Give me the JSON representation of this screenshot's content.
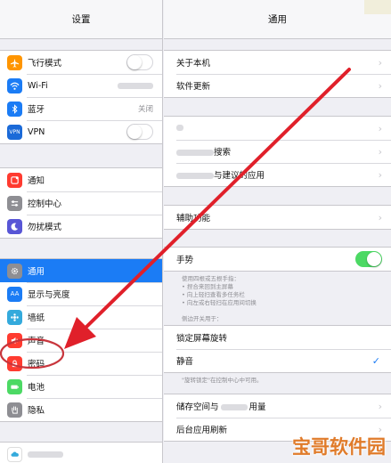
{
  "left": {
    "title": "设置",
    "group1": [
      {
        "label": "飞行模式",
        "icon": "airplane-icon",
        "color": "#ff9500",
        "control": "toggle",
        "on": false
      },
      {
        "label": "Wi-Fi",
        "icon": "wifi-icon",
        "color": "#1b7cf5",
        "control": "blurred"
      },
      {
        "label": "蓝牙",
        "icon": "bluetooth-icon",
        "color": "#1b7cf5",
        "control": "value",
        "value": "关闭"
      },
      {
        "label": "VPN",
        "icon": "vpn-icon",
        "color": "#1b6ad8",
        "icon_text": "VPN",
        "control": "toggle",
        "on": false
      }
    ],
    "group2": [
      {
        "label": "通知",
        "icon": "notifications-icon",
        "color": "#ff3b30"
      },
      {
        "label": "控制中心",
        "icon": "control-center-icon",
        "color": "#8e8e93"
      },
      {
        "label": "勿扰模式",
        "icon": "moon-icon",
        "color": "#5856d6"
      }
    ],
    "group3": [
      {
        "label": "通用",
        "icon": "gear-icon",
        "color": "#8e8e93",
        "selected": true
      },
      {
        "label": "显示与亮度",
        "icon": "display-icon",
        "color": "#1b7cf5",
        "icon_text": "AA"
      },
      {
        "label": "墙纸",
        "icon": "wallpaper-icon",
        "color": "#34aadc"
      },
      {
        "label": "声音",
        "icon": "sound-icon",
        "color": "#ff3b30"
      },
      {
        "label": "密码",
        "icon": "lock-icon",
        "color": "#ff3b30"
      },
      {
        "label": "电池",
        "icon": "battery-icon",
        "color": "#4cd964"
      },
      {
        "label": "隐私",
        "icon": "hand-icon",
        "color": "#8e8e93"
      }
    ]
  },
  "right": {
    "title": "通用",
    "group1": [
      "关于本机",
      "软件更新"
    ],
    "group2": [
      "",
      "搜索",
      "与建议的应用"
    ],
    "group3": [
      "辅助功能"
    ],
    "gestures": {
      "label": "手势",
      "on": true
    },
    "gestures_note": [
      "使用四根或五根手指：",
      "• 捏合来回到主屏幕",
      "• 向上轻扫查看多任务栏",
      "• 向左或右轻扫在应用间切换"
    ],
    "side_switch_header": "侧边开关用于：",
    "side_switch": [
      {
        "label": "锁定屏幕旋转",
        "checked": false
      },
      {
        "label": "静音",
        "checked": true
      }
    ],
    "side_switch_note": "\"旋转锁定\"在控制中心中可用。",
    "group5": [
      {
        "label_a": "储存空间与",
        "label_b": "用量"
      },
      {
        "label_a": "后台应用刷新",
        "label_b": ""
      }
    ]
  },
  "watermark": "宝哥软件园",
  "accent": "#1b7cf5",
  "annotation_color": "#e0202a"
}
